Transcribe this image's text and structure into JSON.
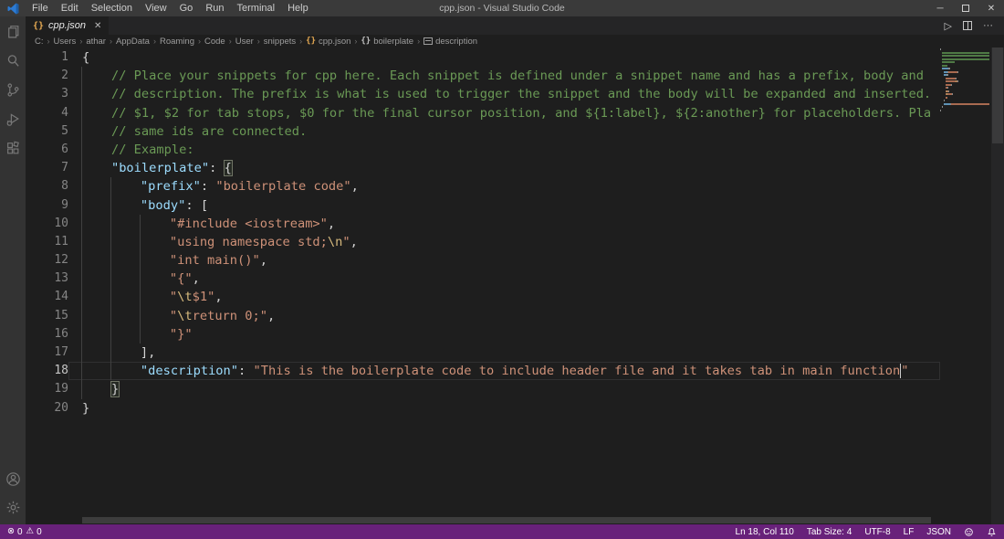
{
  "window": {
    "title": "cpp.json - Visual Studio Code"
  },
  "menu": {
    "items": [
      "File",
      "Edit",
      "Selection",
      "View",
      "Go",
      "Run",
      "Terminal",
      "Help"
    ]
  },
  "tab": {
    "label": "cpp.json",
    "icon": "braces-gold-icon",
    "close": "✕"
  },
  "breadcrumbs": [
    {
      "label": "C:"
    },
    {
      "label": "Users"
    },
    {
      "label": "athar"
    },
    {
      "label": "AppData"
    },
    {
      "label": "Roaming"
    },
    {
      "label": "Code"
    },
    {
      "label": "User"
    },
    {
      "label": "snippets"
    },
    {
      "label": "cpp.json",
      "icon": "braces-gold"
    },
    {
      "label": "boilerplate",
      "icon": "braces"
    },
    {
      "label": "description",
      "icon": "field"
    }
  ],
  "colors": {
    "status_bar_bg": "#68217A",
    "comment": "#6a9955",
    "property": "#9cdcfe",
    "string": "#ce9178",
    "escape": "#d7ba7d",
    "punctuation": "#d4d4d4",
    "editor_bg": "#1e1e1e",
    "activity_bar_bg": "#333333",
    "tab_bar_bg": "#252526"
  },
  "editor": {
    "active_line": 18,
    "lines": [
      {
        "no": 1,
        "guides": 0,
        "segs": [
          {
            "c": "punct",
            "t": "{"
          }
        ]
      },
      {
        "no": 2,
        "guides": 1,
        "segs": [
          {
            "c": "comment",
            "t": "// Place your snippets for cpp here. Each snippet is defined under a snippet name and has a prefix, body and"
          }
        ]
      },
      {
        "no": 3,
        "guides": 1,
        "segs": [
          {
            "c": "comment",
            "t": "// description. The prefix is what is used to trigger the snippet and the body will be expanded and inserted."
          }
        ]
      },
      {
        "no": 4,
        "guides": 1,
        "segs": [
          {
            "c": "comment",
            "t": "// $1, $2 for tab stops, $0 for the final cursor position, and ${1:label}, ${2:another} for placeholders. Pla"
          }
        ]
      },
      {
        "no": 5,
        "guides": 1,
        "segs": [
          {
            "c": "comment",
            "t": "// same ids are connected."
          }
        ]
      },
      {
        "no": 6,
        "guides": 1,
        "segs": [
          {
            "c": "comment",
            "t": "// Example:"
          }
        ]
      },
      {
        "no": 7,
        "guides": 1,
        "segs": [
          {
            "c": "key",
            "t": "\"boilerplate\""
          },
          {
            "c": "punct",
            "t": ": "
          },
          {
            "c": "punct match",
            "t": "{"
          }
        ]
      },
      {
        "no": 8,
        "guides": 2,
        "segs": [
          {
            "c": "key",
            "t": "\"prefix\""
          },
          {
            "c": "punct",
            "t": ": "
          },
          {
            "c": "string",
            "t": "\"boilerplate code\""
          },
          {
            "c": "punct",
            "t": ","
          }
        ]
      },
      {
        "no": 9,
        "guides": 2,
        "segs": [
          {
            "c": "key",
            "t": "\"body\""
          },
          {
            "c": "punct",
            "t": ": "
          },
          {
            "c": "punct",
            "t": "["
          }
        ]
      },
      {
        "no": 10,
        "guides": 3,
        "segs": [
          {
            "c": "string",
            "t": "\"#include <iostream>\""
          },
          {
            "c": "punct",
            "t": ","
          }
        ]
      },
      {
        "no": 11,
        "guides": 3,
        "segs": [
          {
            "c": "string",
            "t": "\"using namespace std;"
          },
          {
            "c": "escape",
            "t": "\\n"
          },
          {
            "c": "string",
            "t": "\""
          },
          {
            "c": "punct",
            "t": ","
          }
        ]
      },
      {
        "no": 12,
        "guides": 3,
        "segs": [
          {
            "c": "string",
            "t": "\"int main()\""
          },
          {
            "c": "punct",
            "t": ","
          }
        ]
      },
      {
        "no": 13,
        "guides": 3,
        "segs": [
          {
            "c": "string",
            "t": "\"{\""
          },
          {
            "c": "punct",
            "t": ","
          }
        ]
      },
      {
        "no": 14,
        "guides": 3,
        "segs": [
          {
            "c": "string",
            "t": "\""
          },
          {
            "c": "escape",
            "t": "\\t"
          },
          {
            "c": "string",
            "t": "$1\""
          },
          {
            "c": "punct",
            "t": ","
          }
        ]
      },
      {
        "no": 15,
        "guides": 3,
        "segs": [
          {
            "c": "string",
            "t": "\""
          },
          {
            "c": "escape",
            "t": "\\t"
          },
          {
            "c": "string",
            "t": "return 0;\""
          },
          {
            "c": "punct",
            "t": ","
          }
        ]
      },
      {
        "no": 16,
        "guides": 3,
        "segs": [
          {
            "c": "string",
            "t": "\"}\""
          }
        ]
      },
      {
        "no": 17,
        "guides": 2,
        "segs": [
          {
            "c": "punct",
            "t": "],"
          }
        ]
      },
      {
        "no": 18,
        "guides": 2,
        "segs": [
          {
            "c": "key",
            "t": "\"description\""
          },
          {
            "c": "punct",
            "t": ": "
          },
          {
            "c": "string",
            "t": "\"This is the boilerplate code to include header file and it takes tab in main function"
          },
          {
            "c": "cursor",
            "t": ""
          },
          {
            "c": "string",
            "t": "\""
          }
        ]
      },
      {
        "no": 19,
        "guides": 1,
        "segs": [
          {
            "c": "punct match",
            "t": "}"
          }
        ]
      },
      {
        "no": 20,
        "guides": 0,
        "segs": [
          {
            "c": "punct",
            "t": "}"
          }
        ]
      }
    ]
  },
  "status": {
    "errors": "0",
    "warnings": "0",
    "cursor_position": "Ln 18, Col 110",
    "tab_size": "Tab Size: 4",
    "encoding": "UTF-8",
    "eol": "LF",
    "language": "JSON"
  }
}
